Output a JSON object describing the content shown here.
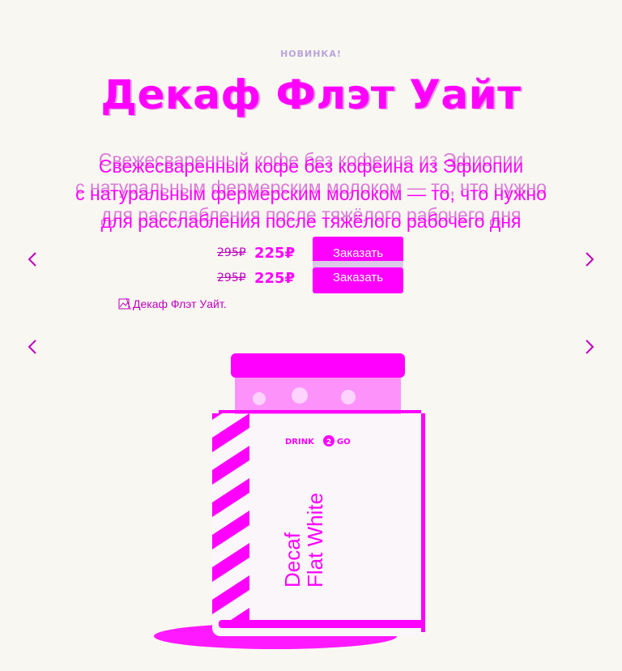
{
  "hero": {
    "badge": "НОВИНКА!",
    "title": "Декаф Флэт Уайт",
    "description": [
      "Свежесваренный кофе без кофеина из Эфиопии",
      "с натуральным фермерским молоком — то, что нужно",
      "для расслабления после тяжёлого рабочего дня"
    ],
    "old_price": "295₽",
    "new_price": "225₽",
    "order_label": "Заказать"
  },
  "image": {
    "alt": "Декаф Флэт Уайт.",
    "brand": "DRINK 2 GO",
    "can_text_line1": "Decaf",
    "can_text_line2": "Flat White"
  },
  "colors": {
    "accent": "#ff00ff",
    "background": "#f9f7f2"
  },
  "icons": [
    "chevron-left-icon",
    "chevron-right-icon",
    "broken-image-icon"
  ]
}
